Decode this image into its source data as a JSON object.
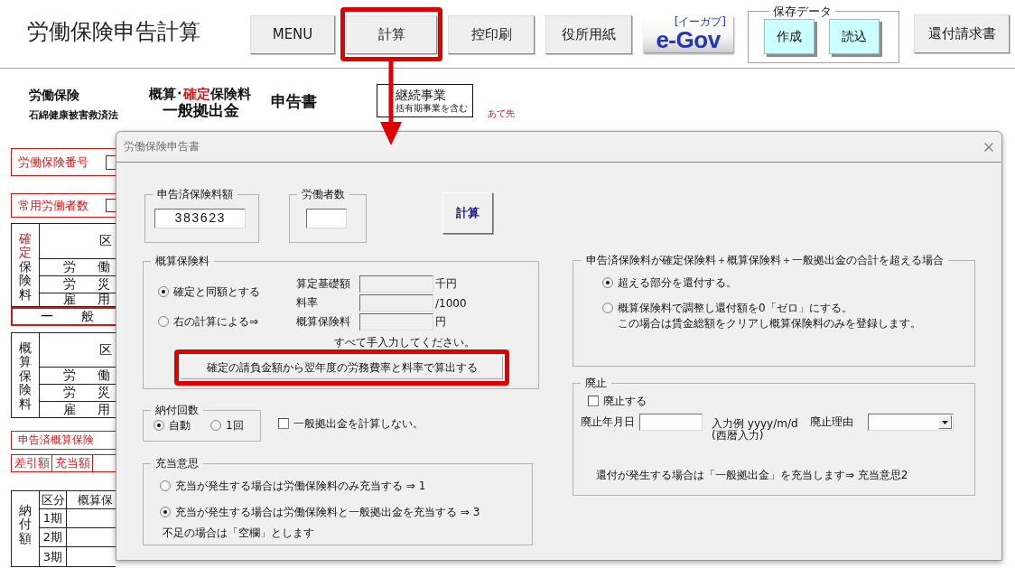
{
  "header": {
    "title": "労働保険申告計算",
    "buttons": [
      {
        "label": "MENU",
        "highlighted": false
      },
      {
        "label": "計算",
        "highlighted": true
      },
      {
        "label": "控印刷",
        "highlighted": false
      },
      {
        "label": "役所用紙",
        "highlighted": false
      }
    ],
    "egov": {
      "logo": "e-Gov",
      "reading": "[イーガブ]"
    },
    "save_data": {
      "title": "保存データ",
      "buttons": [
        "作成",
        "読込"
      ]
    },
    "refund_button": "還付請求書"
  },
  "form_title": {
    "insurance": "労働保険",
    "law": "石綿健康被害救済法",
    "heading": [
      {
        "text": "概算･",
        "emphasis": false
      },
      {
        "text": "確定",
        "emphasis": true
      },
      {
        "text": "保険料",
        "emphasis": false
      }
    ],
    "heading_2": "一般拠出金",
    "doc": "申告書",
    "business_type": "継続事業",
    "business_note": "括有期事業を含む",
    "recipient": "あて先"
  },
  "sheet": {
    "insurance_number": "労働保険番号",
    "regular_workers": "常用労働者数",
    "confirmed_table": {
      "side": [
        {
          "text": "確定",
          "emphasis": true
        },
        {
          "text": "保険料",
          "emphasis": false
        }
      ],
      "header": "区",
      "rows": [
        "労 働",
        "労 災",
        "雇 用"
      ]
    },
    "general_row": "一 般",
    "estimated_table": {
      "side": [
        {
          "text": "概算保険料",
          "emphasis": false
        }
      ],
      "header": "区",
      "rows": [
        "労 働",
        "労 災",
        "雇 用"
      ]
    },
    "declared_estimate": "申告済概算保険",
    "split_cells": [
      "差引額",
      "充当額"
    ],
    "payment_table": {
      "side": "納付額",
      "header": [
        "区分",
        "概算保"
      ],
      "rows": [
        "1期",
        "2期",
        "3期"
      ]
    }
  },
  "dialog": {
    "title": "労働保険申告書",
    "declared": {
      "label": "申告済保険料額",
      "value": "383623"
    },
    "workers": {
      "label": "労働者数"
    },
    "calc_button": "計算",
    "estimate": {
      "title": "概算保険料",
      "options": [
        {
          "label": "確定と同額とする",
          "selected": true
        },
        {
          "label": "右の計算による⇒",
          "selected": false
        }
      ],
      "fields": [
        {
          "label": "算定基礎額",
          "unit": "千円"
        },
        {
          "label": "料率",
          "unit": "/1000"
        },
        {
          "label": "概算保険料",
          "unit": "円"
        }
      ],
      "note": "すべて手入力してください。",
      "button": {
        "label": "確定の請負金額から翌年度の労務費率と料率で算出する",
        "highlighted": true
      }
    },
    "installments": {
      "title": "納付回数",
      "options": [
        {
          "label": "自動",
          "selected": true
        },
        {
          "label": "1回",
          "selected": false
        }
      ]
    },
    "skip_general": {
      "label": "一般拠出金を計算しない。",
      "checked": false
    },
    "allocation": {
      "title": "充当意思",
      "options": [
        {
          "label": "充当が発生する場合は労働保険料のみ充当する ⇒ 1",
          "selected": false
        },
        {
          "label": "充当が発生する場合は労働保険料と一般拠出金を充当する ⇒ 3",
          "selected": true
        }
      ],
      "note": "不足の場合は「空欄」とします"
    },
    "excess": {
      "title": "申告済保険料が確定保険料＋概算保険料＋一般拠出金の合計を超える場合",
      "options": [
        {
          "label": "超える部分を還付する。",
          "selected": true
        },
        {
          "label": "概算保険料で調整し還付額を0「ゼロ」にする。",
          "note": "この場合は賃金総額をクリアし概算保険料のみを登録します。",
          "selected": false
        }
      ]
    },
    "abolition": {
      "title": "廃止",
      "checkbox": {
        "label": "廃止する",
        "checked": false
      },
      "date_label": "廃止年月日",
      "example": "入力例 yyyy/m/d",
      "example_note": "(西暦入力)",
      "reason_label": "廃止理由",
      "note": "還付が発生する場合は「一般拠出金」を充当します⇒ 充当意思2"
    }
  }
}
